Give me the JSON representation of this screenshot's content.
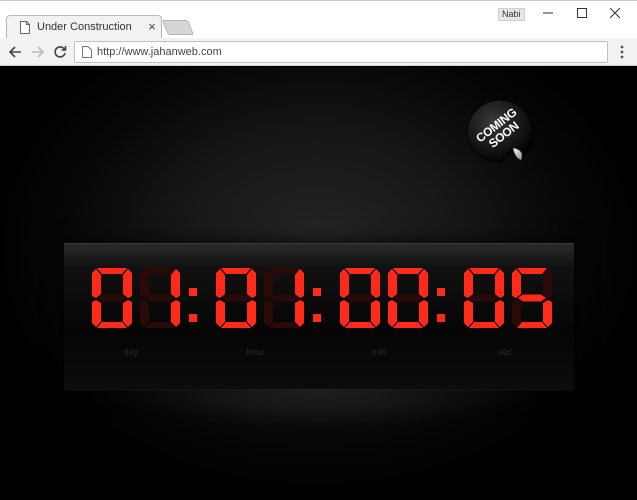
{
  "browser": {
    "tab_title": "Under Construction",
    "close_symbol": "×",
    "user_name": "Nabi",
    "url": "http://www.jahanweb.com",
    "icons": [
      "document-icon",
      "close-icon",
      "back-icon",
      "forward-icon",
      "reload-icon",
      "page-icon",
      "menu-icon",
      "minimize-icon",
      "maximize-icon",
      "window-close-icon"
    ]
  },
  "countdown": {
    "display": "01:01:00:05",
    "digits": [
      "0",
      "1",
      "0",
      "1",
      "0",
      "0",
      "0",
      "5"
    ],
    "labels": {
      "day": "day",
      "hour": "hour",
      "min": "min",
      "sec": "sec"
    },
    "digit_color": "#ff2a1a"
  },
  "sticker": {
    "line1": "COMING",
    "line2": "SOON"
  }
}
